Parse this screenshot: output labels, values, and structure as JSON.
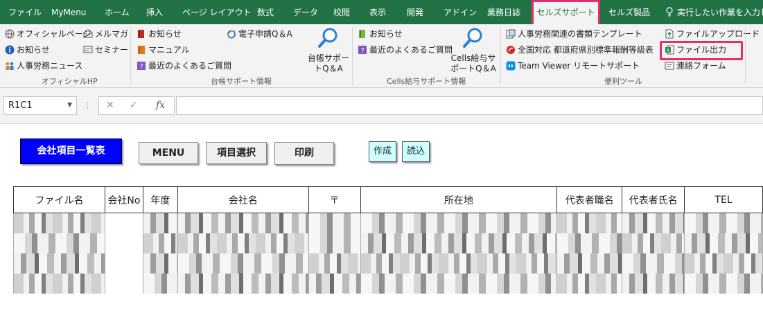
{
  "ribbon_tabs": [
    {
      "label": "ファイル"
    },
    {
      "label": "MyMenu"
    },
    {
      "label": "ホーム"
    },
    {
      "label": "挿入"
    },
    {
      "label": "ページ レイアウト"
    },
    {
      "label": "数式"
    },
    {
      "label": "データ"
    },
    {
      "label": "校閲"
    },
    {
      "label": "表示"
    },
    {
      "label": "開発"
    },
    {
      "label": "アドイン"
    },
    {
      "label": "業務日誌"
    },
    {
      "label": "セルズサポート"
    },
    {
      "label": "セルズ製品"
    }
  ],
  "tell_me": "実行したい作業を入力して",
  "groups": {
    "official": {
      "title": "オフィシャルHP",
      "items": [
        "オフィシャルページ",
        "メルマガ",
        "お知らせ",
        "セミナー",
        "人事労務ニュース"
      ]
    },
    "daicho": {
      "title": "台帳サポート情報",
      "items": [
        "お知らせ",
        "電子申請Q＆A",
        "マニュアル",
        "最近のよくあるご質問"
      ],
      "big_button": "台帳サポートQ＆A"
    },
    "cells_kyuyo": {
      "title": "Cells給与サポート情報",
      "items": [
        "お知らせ",
        "最近のよくあるご質問"
      ],
      "big_button": "Cells給与サポートQ＆A"
    },
    "benri": {
      "title": "便利ツール",
      "items": [
        "人事労務関連の書類テンプレート",
        "ファイルアップロード",
        "全国対応 都道府県別標準報酬等級表",
        "ファイル出力",
        "Team Viewer リモートサポート",
        "連絡フォーム"
      ]
    }
  },
  "formula_bar": {
    "name_box": "R1C1",
    "formula": ""
  },
  "sheet": {
    "buttons": [
      "会社項目一覧表",
      "MENU",
      "項目選択",
      "印刷",
      "作成",
      "読込"
    ],
    "columns": [
      "ファイル名",
      "会社No",
      "年度",
      "会社名",
      "〒",
      "所在地",
      "代表者職名",
      "代表者氏名",
      "TEL"
    ]
  },
  "colors": {
    "excel_green": "#217346",
    "highlight": "#e0306e",
    "menu_blue": "#0000ff",
    "cyan_button": "#ccffff"
  }
}
